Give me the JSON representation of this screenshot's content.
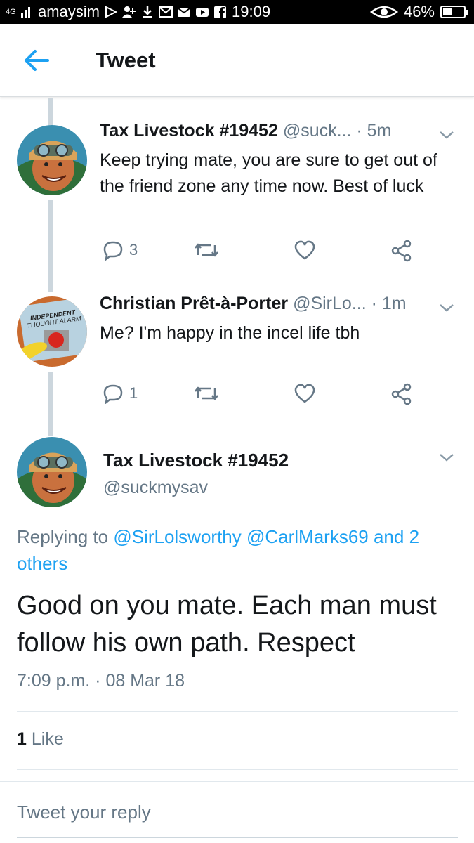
{
  "status_bar": {
    "network": "4G",
    "carrier": "amaysim",
    "time": "19:09",
    "battery": "46%",
    "battery_level": 0.46
  },
  "header": {
    "title": "Tweet"
  },
  "tweets": [
    {
      "name": "Tax Livestock #19452",
      "handle": "@suck...",
      "time": "· 5m",
      "text": "Keep trying mate, you are sure to get out of the friend zone any time now. Best of luck",
      "reply_count": "3"
    },
    {
      "name": "Christian Prêt-à-Porter",
      "handle": "@SirLo...",
      "time": "· 1m",
      "text": "Me? I'm happy in the incel life tbh",
      "reply_count": "1",
      "avatar_text_1": "INDEPENDENT",
      "avatar_text_2": "THOUGHT ALARM"
    }
  ],
  "focus": {
    "name": "Tax Livestock #19452",
    "handle": "@suckmysav",
    "replying_prefix": "Replying to ",
    "replying_links": "@SirLolsworthy @CarlMarks69 and 2 others",
    "text": "Good on you mate. Each man must follow his own path. Respect",
    "timestamp": "7:09 p.m. · 08 Mar 18",
    "like_count": "1",
    "like_label": "Like"
  },
  "reply": {
    "placeholder": "Tweet your reply"
  },
  "colors": {
    "accent": "#1da1f2",
    "muted": "#657786",
    "thread_line": "#ccd6dd"
  }
}
